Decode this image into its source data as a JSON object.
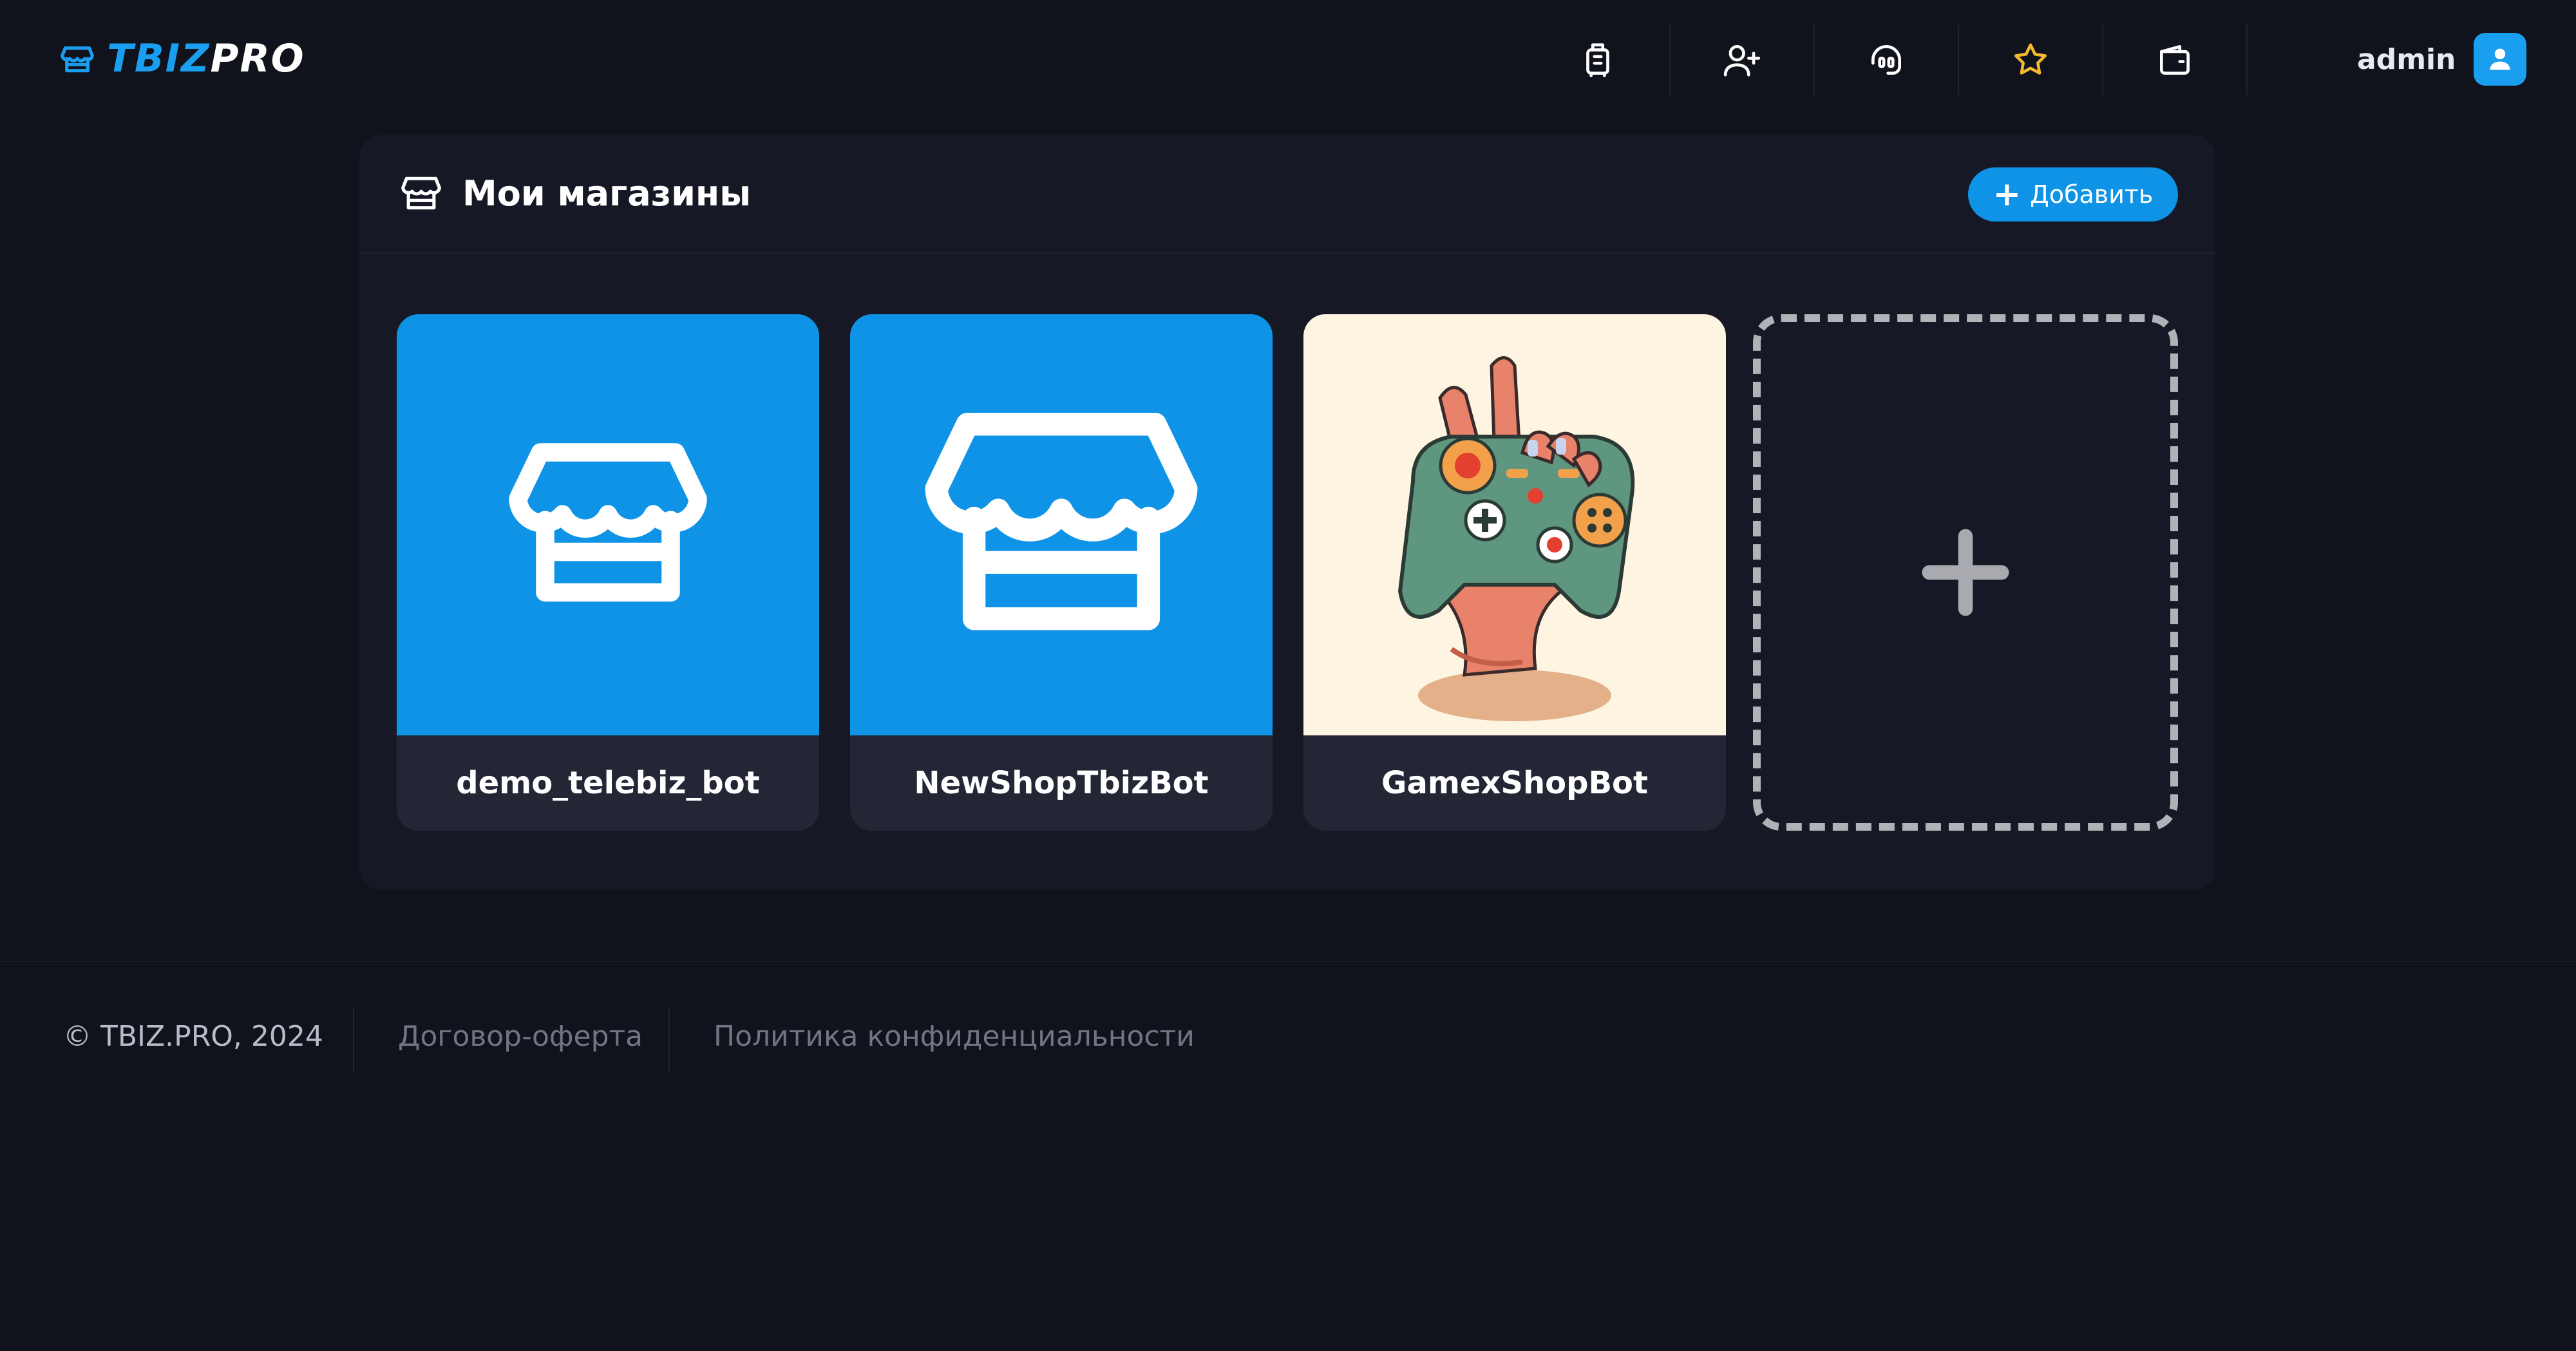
{
  "header": {
    "logo": {
      "part1": "TBIZ",
      "part2": "PRO"
    },
    "nav": [
      {
        "icon": "luggage-icon"
      },
      {
        "icon": "user-plus-icon"
      },
      {
        "icon": "support-headset-icon"
      },
      {
        "icon": "star-icon"
      },
      {
        "icon": "wallet-icon"
      }
    ],
    "user": {
      "name": "admin",
      "icon": "user-avatar-icon"
    }
  },
  "panel": {
    "icon": "store-icon",
    "title": "Мои магазины",
    "add_button": {
      "plus": "+",
      "label": "Добавить"
    },
    "shops": [
      {
        "name": "demo_telebiz_bot",
        "icon": "store-icon",
        "thumb": "blue"
      },
      {
        "name": "NewShopTbizBot",
        "icon": "store-icon",
        "thumb": "blue"
      },
      {
        "name": "GamexShopBot",
        "icon": "gamepad-hand-image",
        "thumb": "cream"
      }
    ],
    "add_card": {
      "icon": "plus-icon"
    }
  },
  "footer": {
    "copyright": "© TBIZ.PRO, 2024",
    "links": [
      "Договор-оферта",
      "Политика конфиденциальности"
    ]
  },
  "colors": {
    "background": "#11131c",
    "panel": "#161925",
    "card": "#222635",
    "accent": "#0e93e6",
    "star": "#f5b82e"
  }
}
